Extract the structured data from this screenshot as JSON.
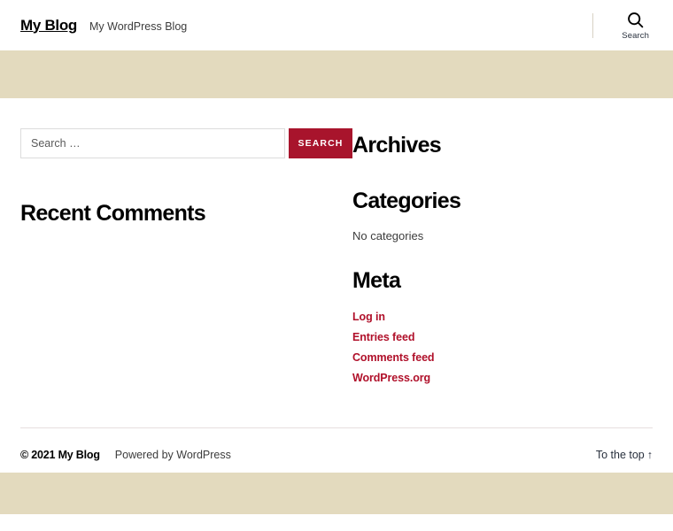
{
  "header": {
    "site_title": "My Blog",
    "tagline": "My WordPress Blog",
    "search_toggle_label": "Search",
    "search_icon": "magnifier-icon"
  },
  "search_widget": {
    "placeholder": "Search …",
    "value": "",
    "submit_label": "SEARCH"
  },
  "sidebar_left": {
    "recent_comments_title": "Recent Comments"
  },
  "sidebar_right": {
    "archives_title": "Archives",
    "categories_title": "Categories",
    "categories_empty": "No categories",
    "meta_title": "Meta",
    "meta_links": [
      {
        "label": "Log in"
      },
      {
        "label": "Entries feed"
      },
      {
        "label": "Comments feed"
      },
      {
        "label": "WordPress.org"
      }
    ]
  },
  "footer": {
    "copyright": "© 2021 My Blog",
    "credit": "Powered by WordPress",
    "to_top": "To the top",
    "to_top_arrow": "↑"
  },
  "colors": {
    "accent_red": "#a8142c",
    "link_red": "#b0102a",
    "band_beige": "#e3dabe",
    "text_dark": "#28303d",
    "rule": "#e6dede"
  }
}
